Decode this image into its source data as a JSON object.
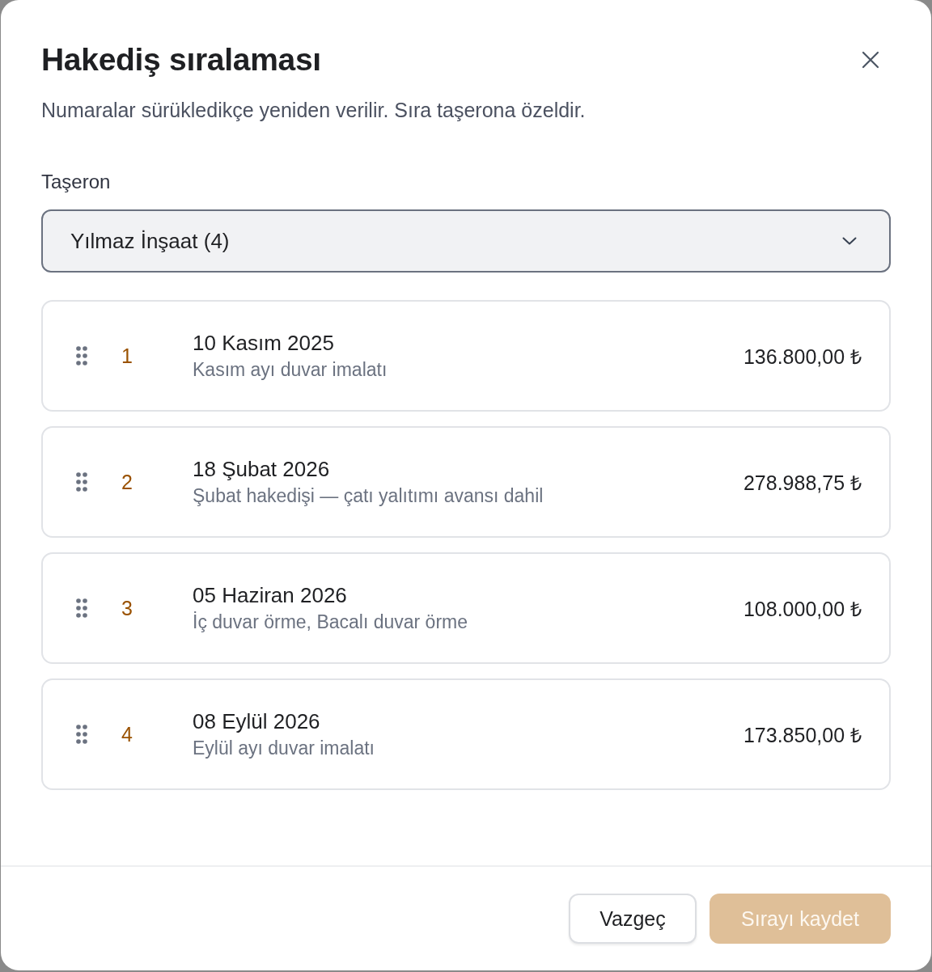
{
  "dialog": {
    "title": "Hakediş sıralaması",
    "description": "Numaralar sürükledikçe yeniden verilir. Sıra taşerona özeldir."
  },
  "subcontractor": {
    "label": "Taşeron",
    "value": "Yılmaz İnşaat (4)"
  },
  "items": [
    {
      "number": "1",
      "date": "10 Kasım 2025",
      "note": "Kasım ayı duvar imalatı",
      "amount": "136.800,00 ₺"
    },
    {
      "number": "2",
      "date": "18 Şubat 2026",
      "note": "Şubat hakedişi — çatı yalıtımı avansı dahil",
      "amount": "278.988,75 ₺"
    },
    {
      "number": "3",
      "date": "05 Haziran 2026",
      "note": "İç duvar örme, Bacalı duvar örme",
      "amount": "108.000,00 ₺"
    },
    {
      "number": "4",
      "date": "08 Eylül 2026",
      "note": "Eylül ayı duvar imalatı",
      "amount": "173.850,00 ₺"
    }
  ],
  "buttons": {
    "cancel": {
      "label": "Vazgeç"
    },
    "save": {
      "label": "Sırayı kaydet",
      "disabled": true
    }
  }
}
